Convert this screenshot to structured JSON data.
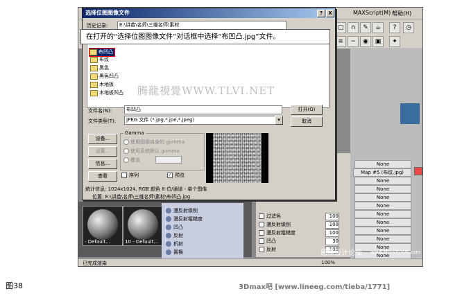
{
  "dialog": {
    "title": "选择位图图像文件",
    "history_label": "历史记录:",
    "history_value": "E:\\讲苗\\名师\\三维名师\\素材",
    "files": [
      "布凹凸",
      "布纹",
      "黑色",
      "黑色凹凸",
      "木地板",
      "木地板凹凸"
    ],
    "selected_file": "布凹凸",
    "filename_label": "文件名(N):",
    "filename_value": "布凹凸",
    "filetype_label": "文件类型(T):",
    "filetype_value": "JPEG 文件 (*.jpg,*.jpe,*.jpeg)",
    "open_button": "打开(O)",
    "cancel_button": "取消",
    "setup_button": "设备...",
    "settings_button": "设置...",
    "info_button": "信息...",
    "view_button": "查看",
    "gamma_title": "Gamma",
    "gamma_opt1": "使用图像自身的 gamma",
    "gamma_opt2": "使用系统默认 gamma",
    "gamma_opt3": "覆盖",
    "sequence_label": "序列",
    "preview_label": "预览",
    "stats": "统计信息: 1024x1024, RGB 颜色 8 位/通道 - 单个图像",
    "location": "位置: E:\\讲苗\\名师\\三维名师\\素材\\布凹凸.jpg",
    "help_btn": "?",
    "close_btn": "X"
  },
  "callout": "在打开的“选择位图图像文件”对话框中选择“布凹凸.jpg”文件。",
  "app": {
    "menu_items": [
      "MAXScript(M)",
      "帮助(H)"
    ],
    "sphere_labels": [
      "- Default...",
      "10 - Default..."
    ],
    "map_rows": [
      "漫反射级别",
      "漫反射粗糙度",
      "凹凸",
      "反射",
      "折射",
      "置换"
    ],
    "param_rows": [
      {
        "label": "过滤色",
        "value": "100"
      },
      {
        "label": "漫反射级别",
        "value": "100"
      },
      {
        "label": "漫反射粗糙度",
        "value": "100"
      },
      {
        "label": "凹凸",
        "value": "30"
      },
      {
        "label": "反射",
        "value": "100"
      }
    ],
    "map_slot": "Map #5 (布纹.jpg)",
    "none_label": "None",
    "status_text": "已完成渲染",
    "zoom": "100%"
  },
  "watermarks": {
    "center": "腾龍視覺WWW.TLVI.NET",
    "bottom_right": "思缘设计论坛",
    "bottom_url": "www.MISSYUAN.com"
  },
  "figure_label": "图38",
  "site_footer": "3Dmax吧  [www.lineeg.com/tieba/1771]",
  "colors": {
    "title_bar": "#0a246a",
    "selection": "#0a246a",
    "highlight_border": "#ff0000"
  }
}
